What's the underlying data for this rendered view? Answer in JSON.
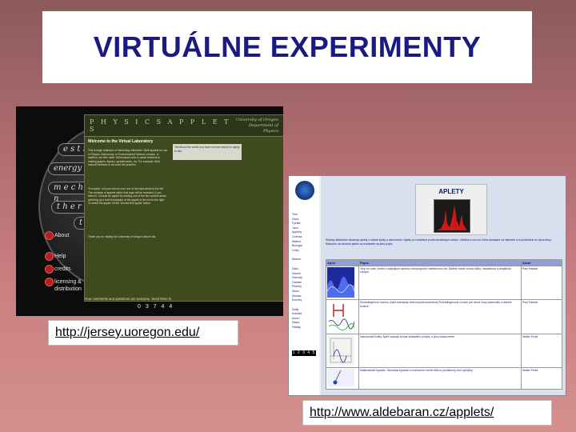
{
  "title": "VIRTUÁLNE EXPERIMENTY",
  "screenshot1": {
    "pills": [
      "e s t r",
      "energy e",
      "m e c h a n",
      "t h e r m",
      "t o"
    ],
    "side_items": [
      "About",
      "Help",
      "credits",
      "licensing & distribution"
    ],
    "physics_heading": "P H Y S I C S   A P P L E T S",
    "university": "University of Oregon",
    "department": "Department of Physics",
    "welcome": "Welcome to the Virtual Laboratory",
    "body_1": "This is large collection of interesting interactive JAVA applets for use in Physics, Astronomy, or Environmental Science courses. In addition, we offer other JAVA-based tools to assist students in making graphs, figures, spreadsheets, etc. For example JAVA manual interface to do solve the problem.",
    "body_2": "To explore, roll your mouse over one of the topic areas to the left. The contents of applets within that topic will be revealed. If you select it. Choose an applet by reading one of the five content areas will bring up a brief description of the applet in the text to the right. To select the applet, hit the 'choose this applet' button.",
    "body_3": "Thank you for visiting the University of Oregon Virtual Lab.",
    "note": "Tell about the world you have chosen above to apply to lab.",
    "footer": "Your comments and questions are welcome. Send them to",
    "counter": "0 3 7 4 4",
    "url": "http://jersey.uoregon.edu/"
  },
  "screenshot2": {
    "aplety": "APLETY",
    "nav": [
      "Titul",
      "Úvod",
      "Fyzika",
      "Java",
      "Applety",
      "Java",
      "Chémia",
      "Matem.",
      "Biológia",
      "Linky",
      "",
      "Meteor",
      "",
      "Dáta",
      "Vesmír",
      "Hviezdy",
      "Galaxie",
      "Planéty",
      "Slnko",
      "Mesiac",
      "Kométy",
      "",
      "Ďalej",
      "Kontakt",
      "Autori",
      "Mapa",
      "Hľadaj"
    ],
    "counter": "1 2 3 4 5 6",
    "intro": "Stránky Aldebaran obsahujú aplety z oblasti fyziky a astronómie. Aplety sú rozdelené podľa tematických celkov. Väčšina z nich sú voľne dostupné na internete a sú preložené do slovenčiny. Kliknutím na obrázok apletu sa dostanete na jeho popis.",
    "table_headers": [
      "Aplet",
      "Popis",
      "Autor"
    ],
    "rows": [
      {
        "desc": "Vlny na vode. Jeden z najkrajších apletov zobrazujúcich interferenciu vĺn. Môžete meniť vlnovú dĺžku, vzdialenosť a amplitúdu zdrojov.",
        "author": "Paul Falstad"
      },
      {
        "desc": "Schrödingerova rovnica. Aplet zobrazuje riešenia jednorozmernej Schrödingerovej rovnice pre rôzne tvary potenciálu a vlastné funkcie.",
        "author": "Paul Falstad"
      },
      {
        "desc": "Harmonické kmity. Aplet ukazuje súčasť kmitavého pohybu a jeho znázornenie.",
        "author": "Walter Fendt"
      },
      {
        "desc": "Matematické kyvadlo. Simulácia kyvadla s možnosťou meniť dĺžku a počiatočný uhol výchylky.",
        "author": "Walter Fendt"
      }
    ],
    "url": "http://www.aldebaran.cz/applets/"
  }
}
